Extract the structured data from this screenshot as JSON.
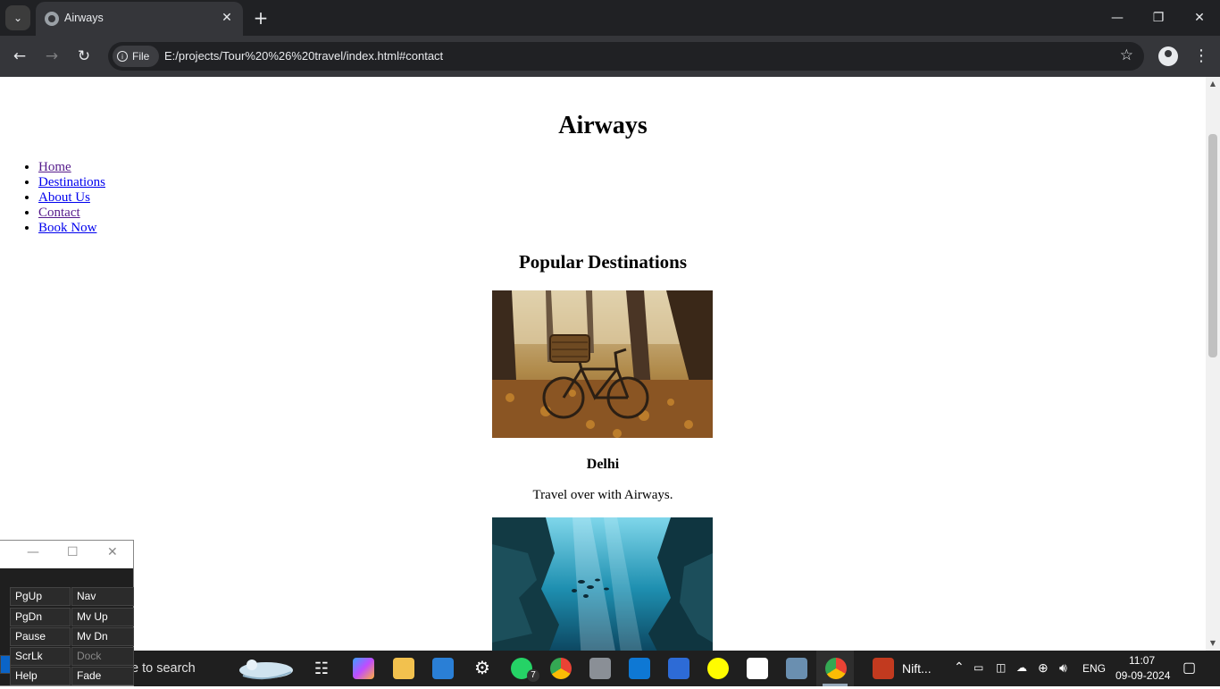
{
  "browser": {
    "tab_title": "Airways",
    "url_chip": "File",
    "url": "E:/projects/Tour%20%26%20travel/index.html#contact",
    "icons": {
      "tab_search": "chevron-down-icon",
      "favicon": "globe-icon",
      "close_tab": "close-icon",
      "new_tab": "plus-icon",
      "back": "arrow-left-icon",
      "forward": "arrow-right-icon",
      "reload": "reload-icon",
      "bookmark": "star-icon",
      "profile": "profile-icon",
      "menu": "kebab-menu-icon"
    }
  },
  "page": {
    "title": "Airways",
    "nav": [
      {
        "label": "Home"
      },
      {
        "label": "Destinations"
      },
      {
        "label": "About Us"
      },
      {
        "label": "Contact"
      },
      {
        "label": "Book Now"
      }
    ],
    "section_title": "Popular Destinations",
    "destinations": [
      {
        "name": "Delhi",
        "description": "Travel over with Airways."
      }
    ],
    "colors": {
      "link": "#0000ee",
      "visited_link": "#551a8b"
    }
  },
  "keyboard_window": {
    "keys": [
      [
        "PgUp",
        "Nav"
      ],
      [
        "PgDn",
        "Mv Up"
      ],
      [
        "Pause",
        "Mv Dn"
      ],
      [
        "ScrLk",
        "Dock"
      ],
      [
        "Help",
        "Fade"
      ]
    ]
  },
  "taskbar": {
    "search_text": "e to search",
    "whatsapp_badge": "7",
    "running_app_label": "Nift...",
    "language": "ENG",
    "time": "11:07",
    "date": "09-09-2024"
  }
}
